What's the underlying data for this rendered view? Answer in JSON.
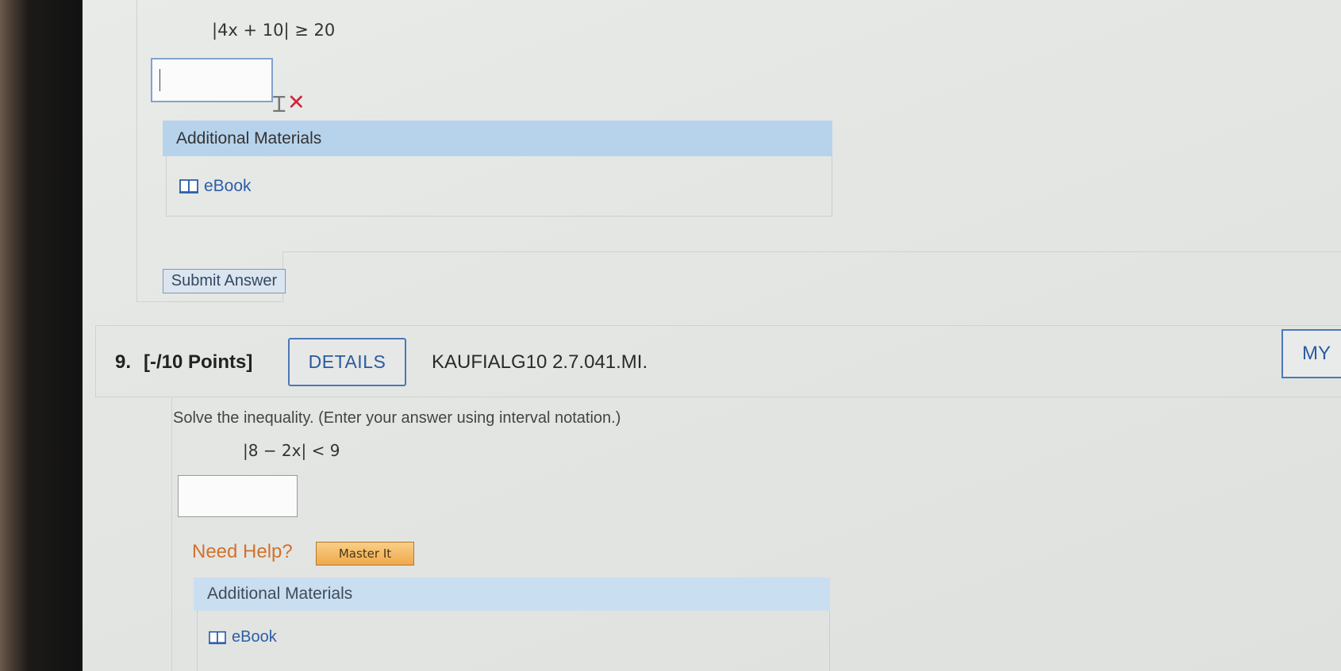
{
  "previous_question": {
    "expression": "|4x + 10| ≥ 20",
    "answer_value": "",
    "status_icon": "x-mark-icon",
    "additional_materials": {
      "header": "Additional Materials",
      "ebook_label": "eBook"
    },
    "submit_label": "Submit Answer"
  },
  "question9": {
    "number": "9.",
    "points": "[-/10 Points]",
    "details_label": "DETAILS",
    "code": "KAUFIALG10 2.7.041.MI.",
    "my_notes_label": "MY",
    "prompt": "Solve the inequality. (Enter your answer using interval notation.)",
    "expression": "|8 − 2x| < 9",
    "answer_value": "",
    "need_help_label": "Need Help?",
    "master_it_label": "Master It",
    "additional_materials": {
      "header": "Additional Materials",
      "ebook_label": "eBook"
    }
  },
  "colors": {
    "accent_blue": "#2a5aa0",
    "header_blue": "#b7d3ec",
    "need_help_orange": "#d3722a",
    "error_red": "#d0243a"
  }
}
